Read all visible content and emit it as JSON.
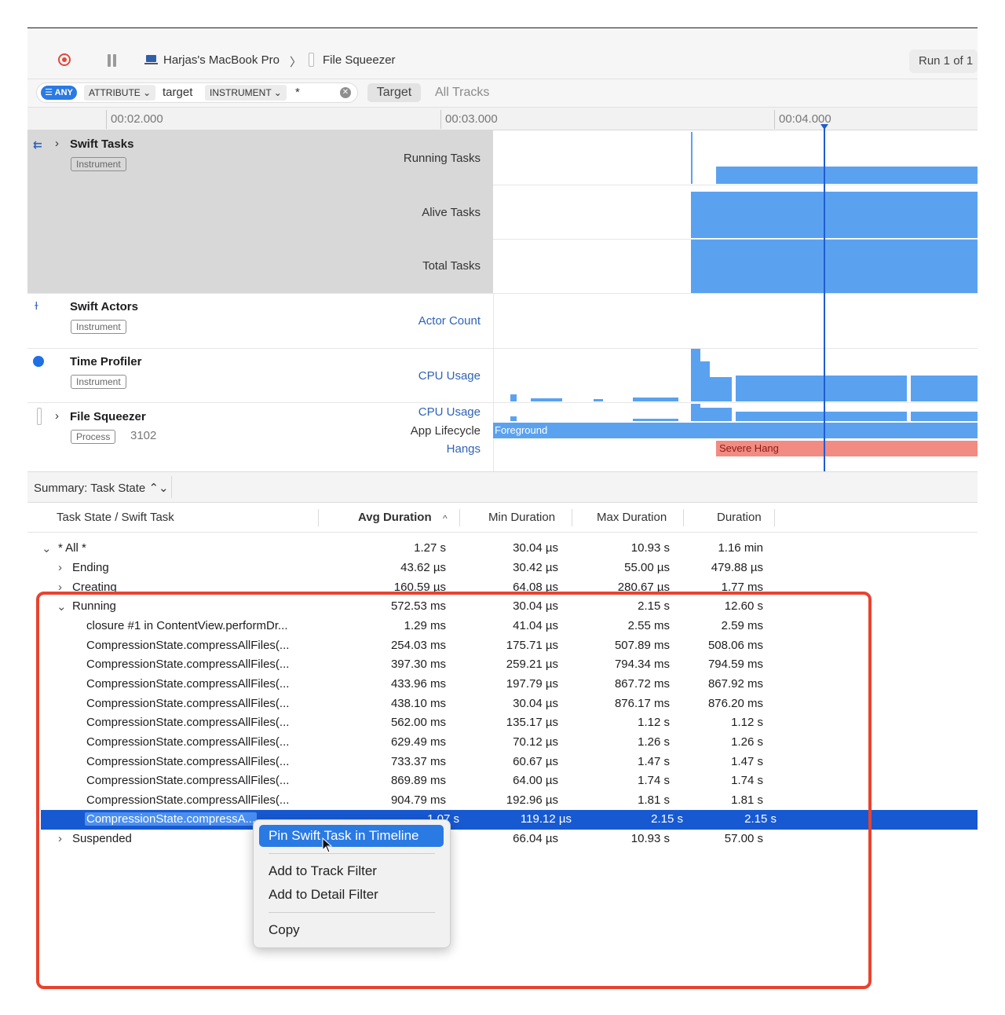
{
  "toolbar": {
    "device": "Harjas's MacBook Pro",
    "separator": "〉",
    "target": "File Squeezer",
    "run": "Run 1 of 1"
  },
  "filter": {
    "any": "☰ ANY",
    "attribute_token": "ATTRIBUTE ⌄",
    "attribute_value": "target",
    "instrument_token": "INSTRUMENT ⌄",
    "instrument_value": "*",
    "scope_selected": "Target",
    "scope_other": "All Tracks"
  },
  "ruler": {
    "ticks": [
      "00:02.000",
      "00:03.000",
      "00:04.000"
    ]
  },
  "tracks": {
    "swift_tasks": {
      "name": "Swift Tasks",
      "badge": "Instrument",
      "lanes": [
        "Running Tasks",
        "Alive Tasks",
        "Total Tasks"
      ]
    },
    "swift_actors": {
      "name": "Swift Actors",
      "badge": "Instrument",
      "lanes": [
        "Actor Count"
      ]
    },
    "time_profiler": {
      "name": "Time Profiler",
      "badge": "Instrument",
      "lanes": [
        "CPU Usage"
      ]
    },
    "file_squeezer": {
      "name": "File Squeezer",
      "badge": "Process",
      "pid": "3102",
      "lanes": [
        "CPU Usage",
        "App Lifecycle",
        "Hangs"
      ],
      "lifecycle_label": "Foreground",
      "hang_label": "Severe Hang"
    }
  },
  "summary": {
    "title": "Summary: Task State ⌃⌄"
  },
  "table": {
    "headers": [
      "Task State / Swift Task",
      "Avg Duration",
      "Min Duration",
      "Max Duration",
      "Duration"
    ],
    "sort_indicator": "^",
    "rows": [
      {
        "name": "* All *",
        "avg": "1.27 s",
        "min": "30.04 µs",
        "max": "10.93 s",
        "dur": "1.16 min"
      },
      {
        "name": "Ending",
        "avg": "43.62 µs",
        "min": "30.42 µs",
        "max": "55.00 µs",
        "dur": "479.88 µs"
      },
      {
        "name": "Creating",
        "avg": "160.59 µs",
        "min": "64.08 µs",
        "max": "280.67 µs",
        "dur": "1.77 ms"
      },
      {
        "name": "Running",
        "avg": "572.53 ms",
        "min": "30.04 µs",
        "max": "2.15 s",
        "dur": "12.60 s"
      },
      {
        "name": "closure #1 in ContentView.performDr...",
        "avg": "1.29 ms",
        "min": "41.04 µs",
        "max": "2.55 ms",
        "dur": "2.59 ms"
      },
      {
        "name": "CompressionState.compressAllFiles(...",
        "avg": "254.03 ms",
        "min": "175.71 µs",
        "max": "507.89 ms",
        "dur": "508.06 ms"
      },
      {
        "name": "CompressionState.compressAllFiles(...",
        "avg": "397.30 ms",
        "min": "259.21 µs",
        "max": "794.34 ms",
        "dur": "794.59 ms"
      },
      {
        "name": "CompressionState.compressAllFiles(...",
        "avg": "433.96 ms",
        "min": "197.79 µs",
        "max": "867.72 ms",
        "dur": "867.92 ms"
      },
      {
        "name": "CompressionState.compressAllFiles(...",
        "avg": "438.10 ms",
        "min": "30.04 µs",
        "max": "876.17 ms",
        "dur": "876.20 ms"
      },
      {
        "name": "CompressionState.compressAllFiles(...",
        "avg": "562.00 ms",
        "min": "135.17 µs",
        "max": "1.12 s",
        "dur": "1.12 s"
      },
      {
        "name": "CompressionState.compressAllFiles(...",
        "avg": "629.49 ms",
        "min": "70.12 µs",
        "max": "1.26 s",
        "dur": "1.26 s"
      },
      {
        "name": "CompressionState.compressAllFiles(...",
        "avg": "733.37 ms",
        "min": "60.67 µs",
        "max": "1.47 s",
        "dur": "1.47 s"
      },
      {
        "name": "CompressionState.compressAllFiles(...",
        "avg": "869.89 ms",
        "min": "64.00 µs",
        "max": "1.74 s",
        "dur": "1.74 s"
      },
      {
        "name": "CompressionState.compressAllFiles(...",
        "avg": "904.79 ms",
        "min": "192.96 µs",
        "max": "1.81 s",
        "dur": "1.81 s"
      },
      {
        "name": "CompressionState.compressA...",
        "avg": "1.07 s",
        "min": "119.12 µs",
        "max": "2.15 s",
        "dur": "2.15 s"
      },
      {
        "name": "Suspended",
        "avg": "",
        "min": "66.04 µs",
        "max": "10.93 s",
        "dur": "57.00 s"
      }
    ]
  },
  "context_menu": {
    "items": [
      "Pin Swift Task in Timeline",
      "Add to Track Filter",
      "Add to Detail Filter",
      "Copy"
    ]
  },
  "colors": {
    "accent": "#2a7ae4",
    "selection": "#1759d1",
    "graph": "#5aa2f0",
    "hang": "#f28b82",
    "highlight_box": "#e8432f"
  }
}
